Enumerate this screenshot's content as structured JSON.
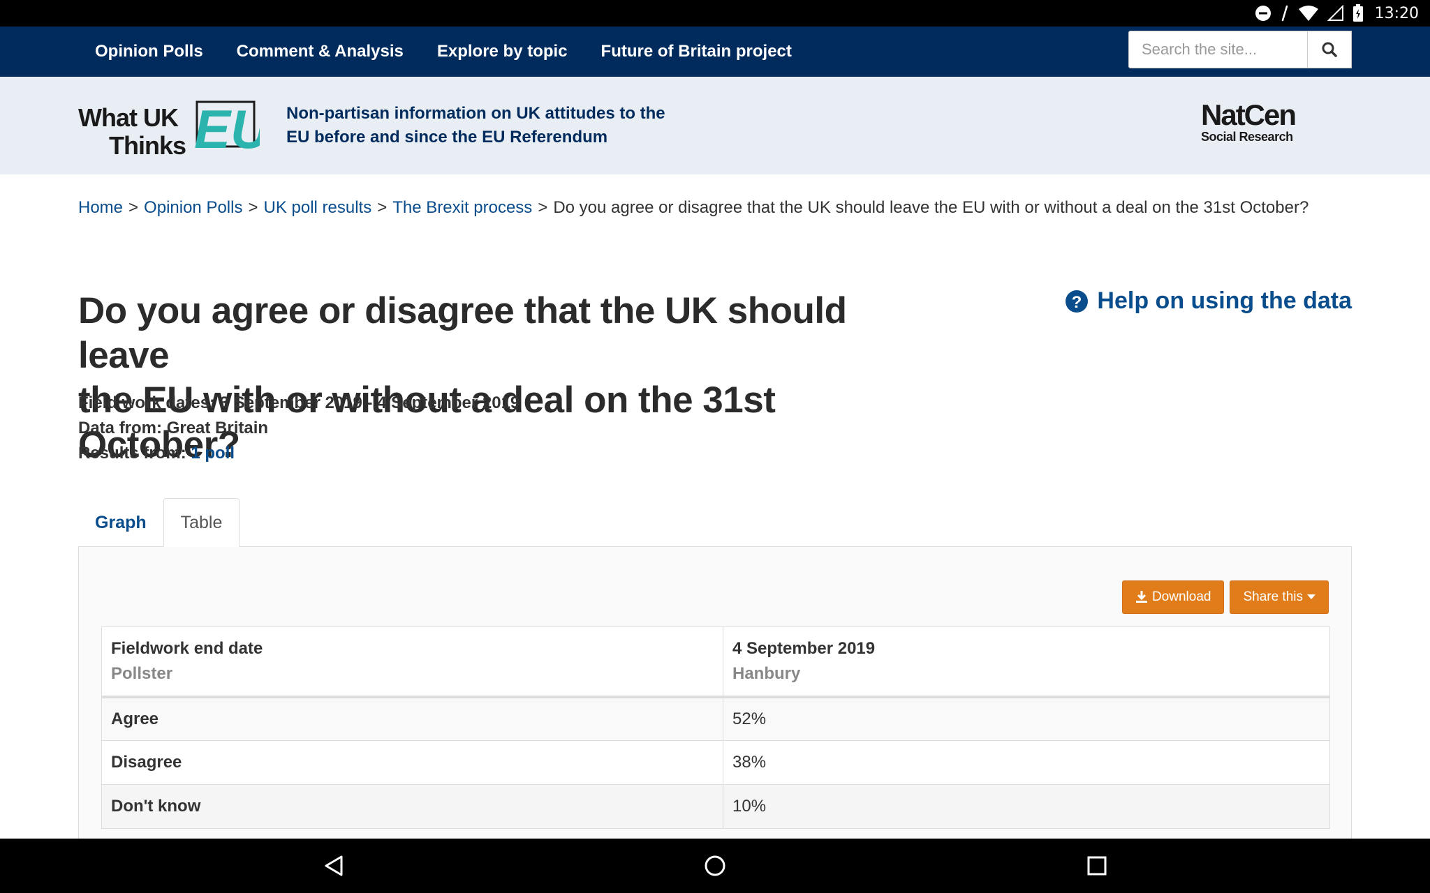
{
  "status_bar": {
    "time": "13:20",
    "icons": [
      "do-not-disturb-icon",
      "signal-icon",
      "wifi-icon",
      "cellular-icon",
      "battery-icon"
    ]
  },
  "topnav": {
    "links": [
      "Opinion Polls",
      "Comment & Analysis",
      "Explore by topic",
      "Future of Britain project"
    ],
    "search_placeholder": "Search the site..."
  },
  "header": {
    "logo_line1": "What UK",
    "logo_line2": "Thinks",
    "logo_mark": "EU",
    "tagline_line1": "Non-partisan information on UK attitudes to the",
    "tagline_line2": "EU before and since the EU Referendum",
    "partner_name": "NatCen",
    "partner_sub": "Social Research"
  },
  "breadcrumb": {
    "items": [
      "Home",
      "Opinion Polls",
      "UK poll results",
      "The Brexit process"
    ],
    "separator": ">",
    "current": "Do you agree or disagree that the UK should leave the EU with or without a deal on the 31st October?"
  },
  "page": {
    "title_line1": "Do you agree or disagree that the UK should leave",
    "title_line2": "the EU with or without a deal on the 31st October?",
    "help_label": "Help on using the data",
    "fieldwork_label": "Field work dates:",
    "fieldwork_value": "3 September 2019 - 4 September 2019",
    "data_from_label": "Data from:",
    "data_from_value": "Great Britain",
    "results_from_label": "Results from:",
    "results_from_value": "1 poll"
  },
  "tabs": [
    "Graph",
    "Table"
  ],
  "actions": {
    "download": "Download",
    "share": "Share this"
  },
  "table": {
    "header_col1_top": "Fieldwork end date",
    "header_col1_sub": "Pollster",
    "header_col2_top": "4 September 2019",
    "header_col2_sub": "Hanbury",
    "rows": [
      {
        "label": "Agree",
        "value": "52%"
      },
      {
        "label": "Disagree",
        "value": "38%"
      },
      {
        "label": "Don't know",
        "value": "10%"
      }
    ]
  },
  "colors": {
    "nav_bg": "#002b5c",
    "header_bg": "#e9eef5",
    "link": "#0a4d8c",
    "brand_teal": "#2bb3ad",
    "button_orange": "#e07c1a"
  }
}
